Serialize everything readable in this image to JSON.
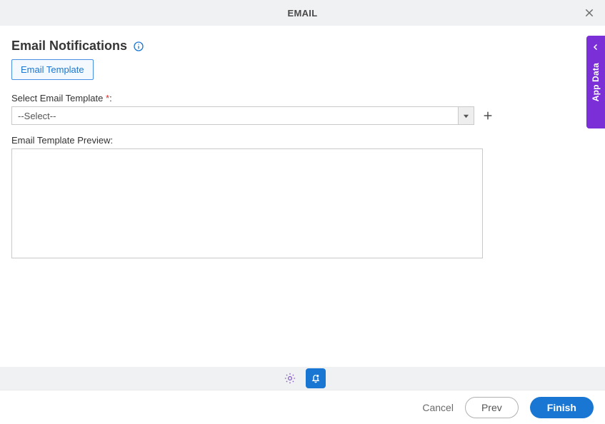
{
  "header": {
    "title": "EMAIL"
  },
  "section": {
    "title": "Email Notifications",
    "tab_label": "Email Template"
  },
  "fields": {
    "select_template_label": "Select Email Template ",
    "select_template_required": "*",
    "select_template_colon": ":",
    "select_template_value": "--Select--",
    "preview_label": "Email Template Preview:"
  },
  "side": {
    "label": "App Data"
  },
  "footer": {
    "cancel": "Cancel",
    "prev": "Prev",
    "finish": "Finish"
  }
}
